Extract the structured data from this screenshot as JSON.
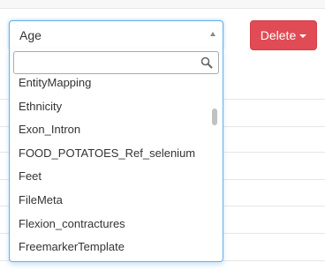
{
  "select": {
    "selected_value": "Age",
    "search_placeholder": "",
    "options": [
      "EntityMapping",
      "Ethnicity",
      "Exon_Intron",
      "FOOD_POTATOES_Ref_selenium",
      "Feet",
      "FileMeta",
      "Flexion_contractures",
      "FreemarkerTemplate"
    ]
  },
  "actions": {
    "delete_label": "Delete"
  },
  "colors": {
    "focus_border": "#66afe9",
    "delete_bg": "#e04b55"
  },
  "icons": {
    "search": "search-icon",
    "select_caret": "caret-up-icon",
    "delete_caret": "caret-down-icon"
  }
}
